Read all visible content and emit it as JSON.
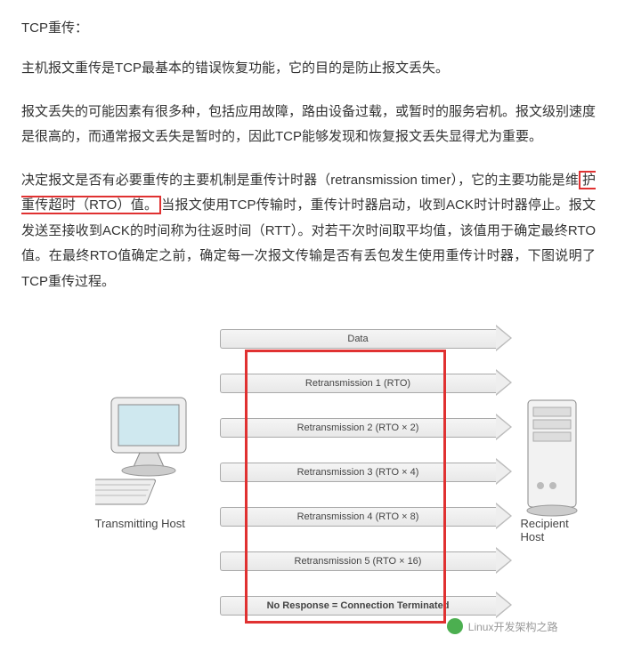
{
  "title": "TCP重传：",
  "para1": "主机报文重传是TCP最基本的错误恢复功能，它的目的是防止报文丢失。",
  "para2": "报文丢失的可能因素有很多种，包括应用故障，路由设备过载，或暂时的服务宕机。报文级别速度是很高的，而通常报文丢失是暂时的，因此TCP能够发现和恢复报文丢失显得尤为重要。",
  "p3a": "决定报文是否有必要重传的主要机制是重传计时器（retransmission timer），它的主要功能是维",
  "p3hl": "护重传超时（RTO）值。",
  "p3b": "当报文使用TCP传输时，重传计时器启动，收到ACK时计时器停止。报文发送至接收到ACK的时间称为往返时间（RTT）。对若干次时间取平均值，该值用于确定最终RTO值。在最终RTO值确定之前，确定每一次报文传输是否有丢包发生使用重传计时器，下图说明了TCP重传过程。",
  "arrows": {
    "a0": "Data",
    "a1": "Retransmission 1 (RTO)",
    "a2": "Retransmission 2 (RTO × 2)",
    "a3": "Retransmission 3 (RTO × 4)",
    "a4": "Retransmission 4 (RTO × 8)",
    "a5": "Retransmission 5 (RTO × 16)",
    "a6": "No Response = Connection Terminated"
  },
  "tx_host": "Transmitting Host",
  "rx_host": "Recipient Host",
  "watermark": "Linux开发架构之路"
}
